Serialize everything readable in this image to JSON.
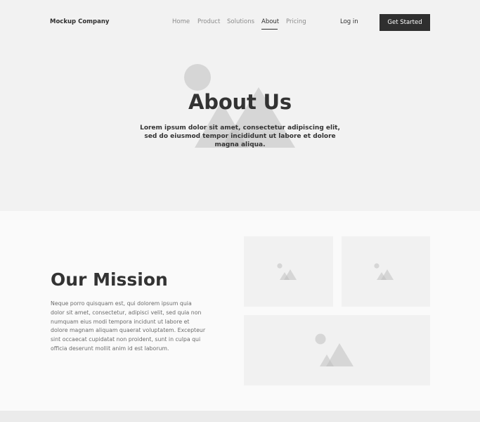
{
  "header": {
    "brand": "Mockup Company",
    "nav": [
      "Home",
      "Product",
      "Solutions",
      "About",
      "Pricing"
    ],
    "active_nav": "About",
    "login_label": "Log in",
    "cta_label": "Get Started"
  },
  "hero": {
    "title": "About Us",
    "subtitle": "Lorem ipsum dolor sit amet, consectetur adipiscing elit, sed do eiusmod tempor incididunt ut labore et dolore magna aliqua.",
    "illustration_icon": "image-placeholder-icon"
  },
  "mission": {
    "title": "Our Mission",
    "body": "Neque porro quisquam est, qui dolorem ipsum quia dolor sit amet, consectetur, adipisci velit, sed quia non numquam eius modi tempora incidunt ut labore et dolore magnam aliquam quaerat voluptatem. Excepteur sint occaecat cupidatat non proident, sunt in culpa qui officia deserunt mollit anim id est laborum.",
    "images": [
      "image-placeholder-icon",
      "image-placeholder-icon",
      "image-placeholder-icon"
    ]
  },
  "colors": {
    "page_bg": "#f2f2f2",
    "section_bg": "#fafafa",
    "text_dark": "#333333",
    "nav_muted": "#8b8b8b",
    "button_bg": "#2f2f2f",
    "placeholder_shape": "#d6d6d6"
  }
}
